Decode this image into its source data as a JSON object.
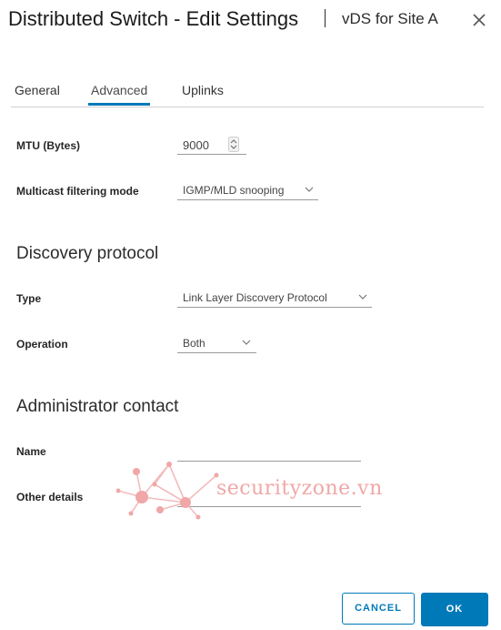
{
  "dialog": {
    "title": "Distributed Switch - Edit Settings",
    "subtitle": "vDS for Site A"
  },
  "tabs": [
    {
      "label": "General",
      "active": false
    },
    {
      "label": "Advanced",
      "active": true
    },
    {
      "label": "Uplinks",
      "active": false
    }
  ],
  "fields": {
    "mtu_label": "MTU (Bytes)",
    "mtu_value": "9000",
    "multicast_label": "Multicast filtering mode",
    "multicast_value": "IGMP/MLD snooping"
  },
  "discovery": {
    "section_title": "Discovery protocol",
    "type_label": "Type",
    "type_value": "Link Layer Discovery Protocol",
    "operation_label": "Operation",
    "operation_value": "Both"
  },
  "admin": {
    "section_title": "Administrator contact",
    "name_label": "Name",
    "name_value": "",
    "other_label": "Other details",
    "other_value": ""
  },
  "watermark": {
    "text": "securityzone.vn"
  },
  "buttons": {
    "cancel": "CANCEL",
    "ok": "OK"
  },
  "colors": {
    "accent": "#0079b8",
    "watermark": "#f0a7a7"
  }
}
